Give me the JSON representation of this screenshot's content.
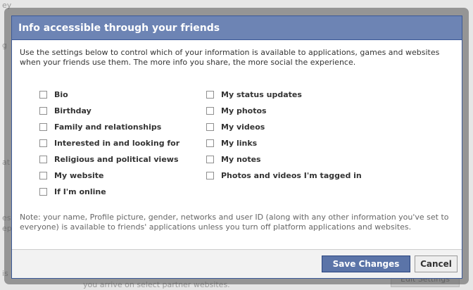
{
  "background": {
    "texts": [
      "ey",
      "g",
      "at",
      "es",
      "ep",
      "is",
      "you arrive on select partner websites."
    ],
    "button_label": "Edit Settings"
  },
  "dialog": {
    "title": "Info accessible through your friends",
    "intro": "Use the settings below to control which of your information is available to applications, games and websites when your friends use them. The more info you share, the more social the experience.",
    "options_left": [
      {
        "label": "Bio",
        "checked": false
      },
      {
        "label": "Birthday",
        "checked": false
      },
      {
        "label": "Family and relationships",
        "checked": false
      },
      {
        "label": "Interested in and looking for",
        "checked": false
      },
      {
        "label": "Religious and political views",
        "checked": false
      },
      {
        "label": "My website",
        "checked": false
      },
      {
        "label": "If I'm online",
        "checked": false
      }
    ],
    "options_right": [
      {
        "label": "My status updates",
        "checked": false
      },
      {
        "label": "My photos",
        "checked": false
      },
      {
        "label": "My videos",
        "checked": false
      },
      {
        "label": "My links",
        "checked": false
      },
      {
        "label": "My notes",
        "checked": false
      },
      {
        "label": "Photos and videos I'm tagged in",
        "checked": false
      }
    ],
    "note": "Note: your name, Profile picture, gender, networks and user ID (along with any other information you've set to everyone) is available to friends' applications unless you turn off platform applications and websites.",
    "buttons": {
      "save": "Save Changes",
      "cancel": "Cancel"
    }
  }
}
